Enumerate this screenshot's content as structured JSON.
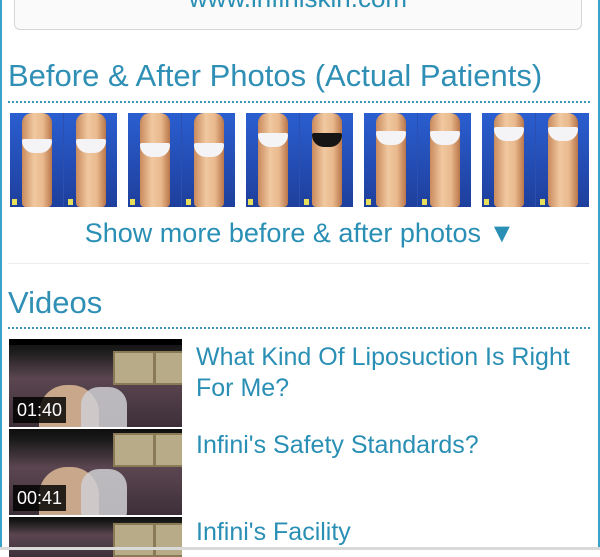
{
  "top_link": "www.infiniskin.com",
  "photos_section": {
    "title": "Before & After Photos (Actual Patients)",
    "thumbnail_count_shown": 5,
    "more_link": "Show more before & after photos ▼"
  },
  "videos_section": {
    "title": "Videos",
    "items": [
      {
        "title": "What Kind Of Liposuction Is Right For Me?",
        "duration": "01:40"
      },
      {
        "title": "Infini's Safety Standards?",
        "duration": "00:41"
      },
      {
        "title": "Infini's Facility",
        "duration": ""
      }
    ]
  },
  "colors": {
    "link": "#2a8fb4",
    "rule": "#3a95b9",
    "frame": "#3aa3c9"
  }
}
